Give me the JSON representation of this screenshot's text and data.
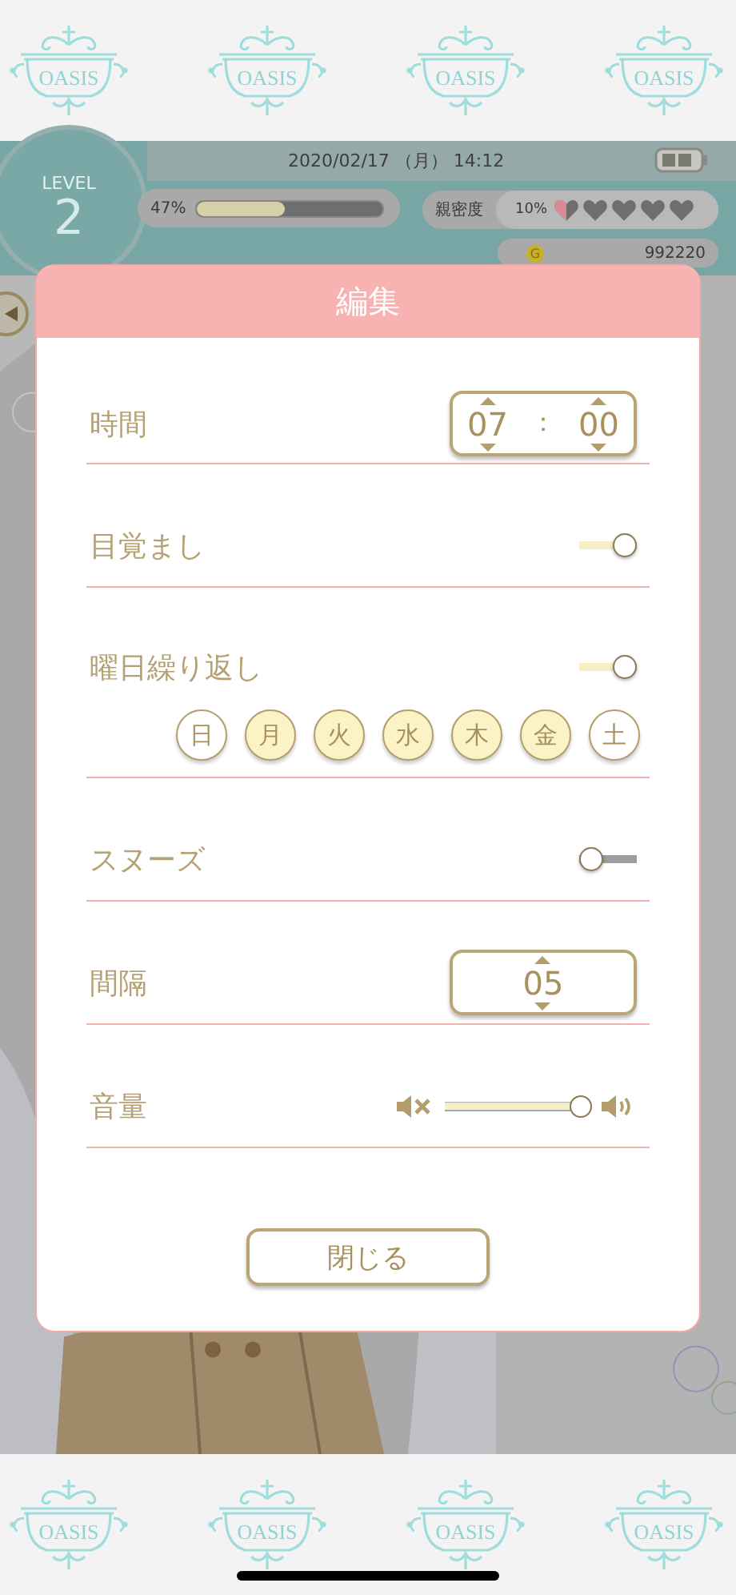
{
  "top_banner": {
    "logos": [
      "OASIS",
      "OASIS",
      "OASIS",
      "OASIS"
    ]
  },
  "status_header": {
    "level_label": "LEVEL",
    "level": "2",
    "datetime": "2020/02/17 （月） 14:12",
    "experience": {
      "reading": "47%",
      "level": 0.47
    },
    "intimacy": {
      "label": "親密度",
      "reading": "10%",
      "hearts": [
        {
          "kind": "half"
        },
        {
          "kind": "empty"
        },
        {
          "kind": "empty"
        },
        {
          "kind": "empty"
        },
        {
          "kind": "empty"
        }
      ]
    },
    "coin_symbol": "G",
    "coins": "992220"
  },
  "dialog": {
    "title": "編集",
    "rows": [
      {
        "kind": "time",
        "label": "時間",
        "hours": "07",
        "separator": "：",
        "minutes": "00"
      },
      {
        "kind": "toggle",
        "label": "目覚まし",
        "on": true
      },
      {
        "kind": "weekdays",
        "label": "曜日繰り返し",
        "on": true,
        "days": [
          {
            "label": "日",
            "selected": false
          },
          {
            "label": "月",
            "selected": true
          },
          {
            "label": "火",
            "selected": true
          },
          {
            "label": "水",
            "selected": true
          },
          {
            "label": "木",
            "selected": true
          },
          {
            "label": "金",
            "selected": true
          },
          {
            "label": "土",
            "selected": false
          }
        ]
      },
      {
        "kind": "toggle",
        "label": "スヌーズ",
        "on": false
      },
      {
        "kind": "number",
        "label": "間隔",
        "value": "05"
      },
      {
        "kind": "volume",
        "label": "音量",
        "level": 0.95
      }
    ],
    "close_button": "閉じる"
  },
  "bottom_banner": {
    "logos": [
      "OASIS",
      "OASIS",
      "OASIS",
      "OASIS"
    ]
  }
}
